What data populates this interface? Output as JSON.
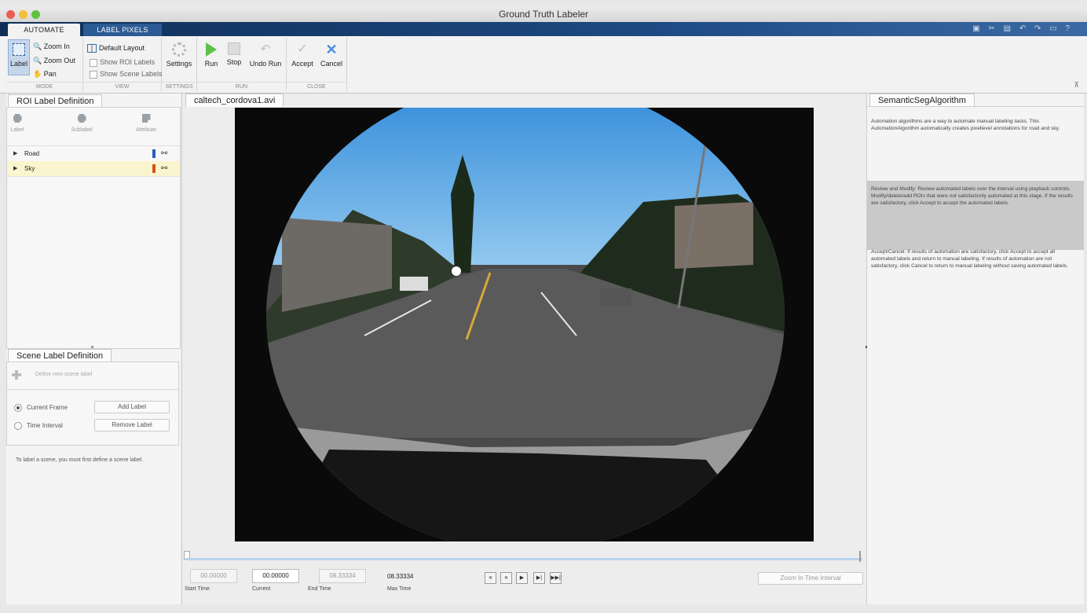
{
  "window": {
    "title": "Ground Truth Labeler",
    "controls_colors": [
      "#ee5b54",
      "#f4bd3b",
      "#5fc33f"
    ]
  },
  "ribbon_tabs": {
    "automate": "AUTOMATE",
    "label_pixels": "LABEL PIXELS"
  },
  "ribbon": {
    "mode": {
      "label": "Label",
      "zoom_in": "Zoom In",
      "zoom_out": "Zoom Out",
      "pan": "Pan",
      "group": "MODE"
    },
    "view": {
      "default_layout": "Default Layout",
      "show_roi_labels": "Show ROI Labels",
      "show_scene_labels": "Show Scene Labels",
      "group": "VIEW"
    },
    "settings": {
      "settings": "Settings",
      "group": "SETTINGS"
    },
    "run": {
      "run": "Run",
      "stop": "Stop",
      "undo_run": "Undo Run",
      "group": "RUN"
    },
    "close": {
      "accept": "Accept",
      "cancel": "Cancel",
      "group": "CLOSE"
    }
  },
  "roi_panel": {
    "tab": "ROI Label Definition",
    "buttons": {
      "label": "Label",
      "sublabel": "Sublabel",
      "attribute": "Attribute"
    },
    "labels": [
      {
        "name": "Road",
        "color": "#2a5fb6"
      },
      {
        "name": "Sky",
        "color": "#d8501a"
      }
    ]
  },
  "scene_panel": {
    "tab": "Scene Label Definition",
    "define_placeholder": "Define new scene label",
    "current_frame": "Current Frame",
    "time_interval": "Time Interval",
    "add_label": "Add Label",
    "remove_label": "Remove Label",
    "hint": "To label a scene, you must first define a scene label."
  },
  "video": {
    "tab": "caltech_cordova1.avi",
    "start_time": "00.00000",
    "current_time": "00.00000",
    "end_time": "08.33334",
    "max_time": "08.33334",
    "start_label": "Start Time",
    "current_label": "Current",
    "end_label": "End Time",
    "max_label": "Max Time",
    "zoom_interval": "Zoom In Time Interval"
  },
  "algorithm_panel": {
    "tab": "SemanticSegAlgorithm",
    "intro": "Automation algorithms are a way to automate manual labeling tasks. This AutomationAlgorithm automatically creates pixellevel annotations for road and sky.",
    "review": "Review and Modify: Review automated labels over the interval using playback controls. Modify/delete/add ROIs that were not satisfactorily automated at this stage. If the results are satisfactory, click Accept to accept the automated labels.",
    "accept_cancel": "Accept/Cancel: If results of automation are satisfactory, click Accept to accept all automated labels and return to manual labeling. If results of automation are not satisfactory, click Cancel to return to manual labeling without saving automated labels."
  }
}
